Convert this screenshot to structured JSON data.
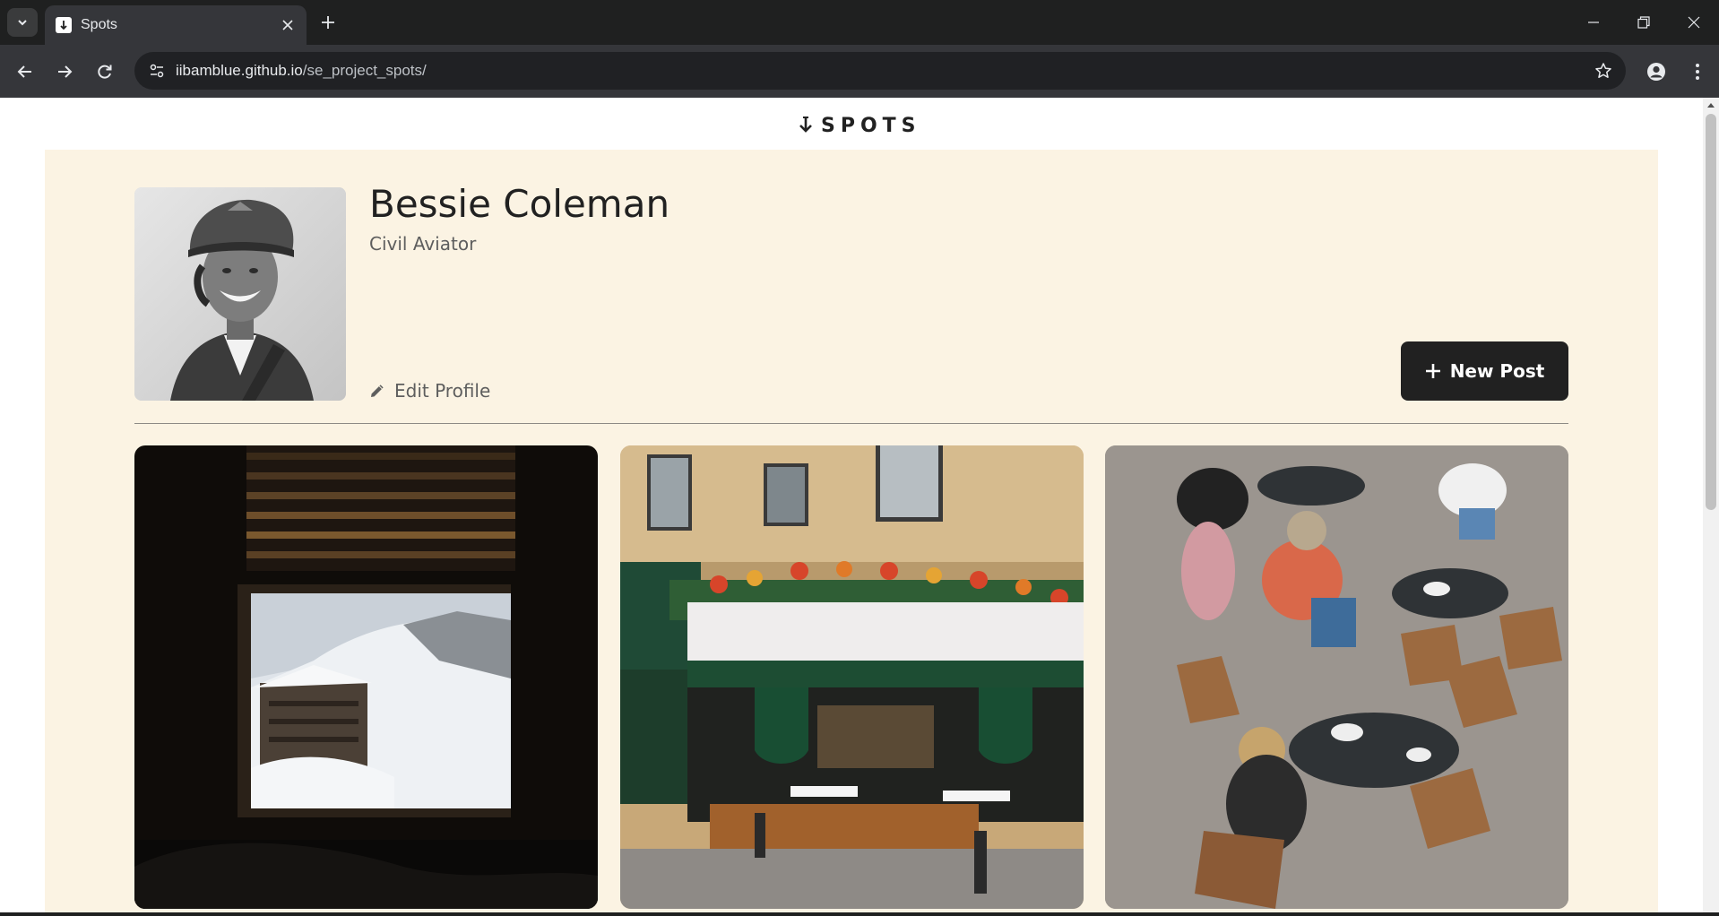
{
  "browser": {
    "tab_title": "Spots",
    "url_host": "iibamblue.github.io",
    "url_path": "/se_project_spots/",
    "icons": [
      "tab-search-icon",
      "close-icon",
      "plus-icon",
      "minimize-icon",
      "restore-icon",
      "window-close-icon",
      "back-icon",
      "forward-icon",
      "reload-icon",
      "site-info-icon",
      "star-icon",
      "profile-icon",
      "more-vert-icon"
    ]
  },
  "header": {
    "logo_text": "SPOTS"
  },
  "profile": {
    "name": "Bessie Coleman",
    "description": "Civil Aviator",
    "edit_label": "Edit Profile",
    "new_post_label": "New Post"
  },
  "colors": {
    "page_background": "#fbf3e3",
    "text_primary": "#212121",
    "text_secondary": "#5e5e5e",
    "button_background": "#212121",
    "divider": "#8d8a85"
  },
  "cards": [
    {
      "image": "Snowy mountain resort seen through a dark window"
    },
    {
      "image": "Parisian restaurant front with flower-covered awning"
    },
    {
      "image": "Outdoor cafe terrace with people at round tables"
    }
  ]
}
